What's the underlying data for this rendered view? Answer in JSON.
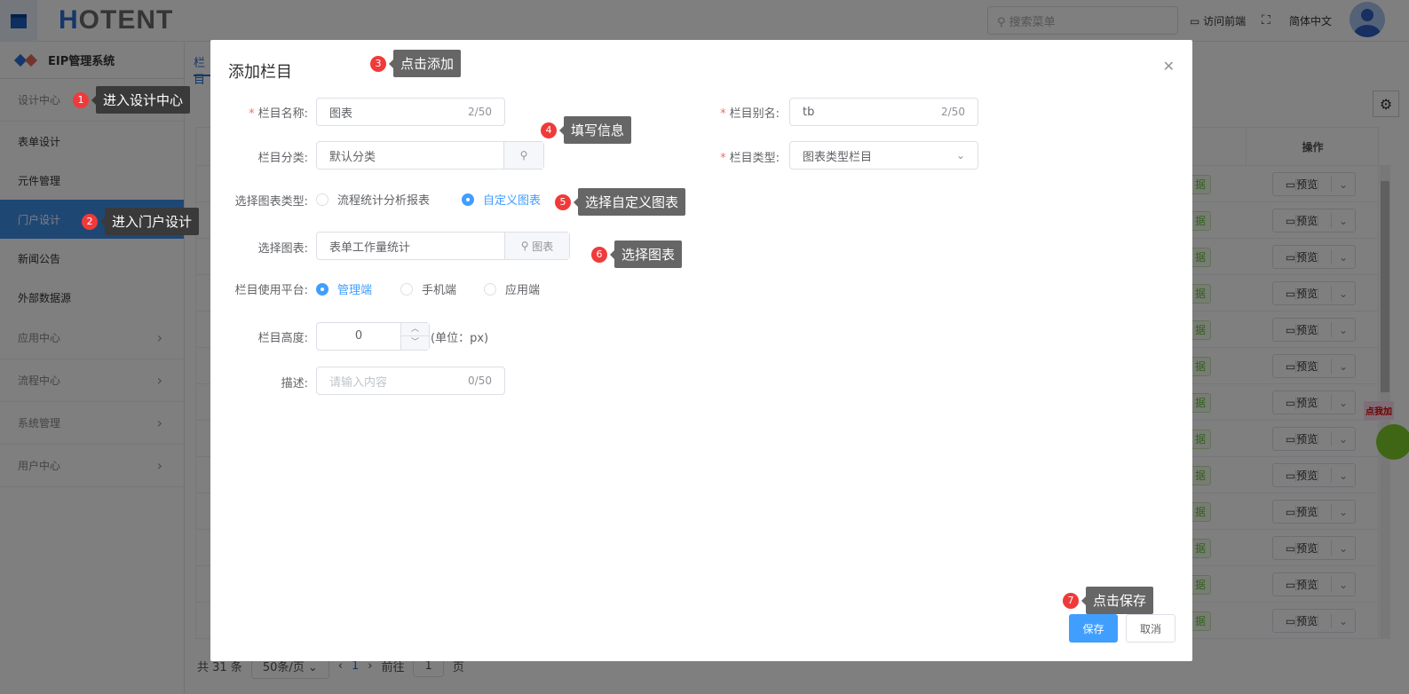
{
  "header": {
    "logo": "HOTENT",
    "search_placeholder": "搜索菜单",
    "visit_frontend": "访问前端",
    "language": "简体中文"
  },
  "sidebar": {
    "system_name": "EIP管理系统",
    "items": [
      {
        "label": "设计中心",
        "type": "group"
      },
      {
        "label": "表单设计",
        "type": "item"
      },
      {
        "label": "元件管理",
        "type": "item"
      },
      {
        "label": "门户设计",
        "type": "item",
        "active": true
      },
      {
        "label": "新闻公告",
        "type": "item"
      },
      {
        "label": "外部数据源",
        "type": "item"
      },
      {
        "label": "应用中心",
        "type": "group"
      },
      {
        "label": "流程中心",
        "type": "group"
      },
      {
        "label": "系统管理",
        "type": "group"
      },
      {
        "label": "用户中心",
        "type": "group"
      }
    ]
  },
  "main": {
    "tab": "栏目",
    "table_header_op": "操作",
    "row_tag": "据",
    "preview_label": "预览",
    "row_count": 13,
    "pager": {
      "total": "共 31 条",
      "page_size": "50条/页",
      "current_page": "1",
      "goto_label": "前往",
      "goto_value": "1",
      "page_suffix": "页"
    }
  },
  "mascot": {
    "text": "点我加"
  },
  "dialog": {
    "title": "添加栏目",
    "fields": {
      "name": {
        "label": "栏目名称:",
        "value": "图表",
        "count": "2/50",
        "required": true
      },
      "alias": {
        "label": "栏目别名:",
        "value": "tb",
        "count": "2/50",
        "required": true
      },
      "category": {
        "label": "栏目分类:",
        "value": "默认分类"
      },
      "type": {
        "label": "栏目类型:",
        "value": "图表类型栏目",
        "required": true
      },
      "chart_type": {
        "label": "选择图表类型:",
        "options": [
          "流程统计分析报表",
          "自定义图表"
        ],
        "selected": "自定义图表"
      },
      "chart": {
        "label": "选择图表:",
        "value": "表单工作量统计",
        "button": "图表"
      },
      "platform": {
        "label": "栏目使用平台:",
        "options": [
          "管理端",
          "手机端",
          "应用端"
        ],
        "selected": "管理端"
      },
      "height": {
        "label": "栏目高度:",
        "value": "0",
        "unit": "(单位：px)"
      },
      "desc": {
        "label": "描述:",
        "placeholder": "请输入内容",
        "count": "0/50"
      }
    },
    "save": "保存",
    "cancel": "取消"
  },
  "tips": [
    {
      "num": "1",
      "text": "进入设计中心"
    },
    {
      "num": "2",
      "text": "进入门户设计"
    },
    {
      "num": "3",
      "text": "点击添加"
    },
    {
      "num": "4",
      "text": "填写信息"
    },
    {
      "num": "5",
      "text": "选择自定义图表"
    },
    {
      "num": "6",
      "text": "选择图表"
    },
    {
      "num": "7",
      "text": "点击保存"
    }
  ],
  "colors": {
    "primary": "#409eff",
    "active_nav": "#3f8ee8",
    "tip_badge": "#f03a3a",
    "tip_bg": "#666666"
  }
}
